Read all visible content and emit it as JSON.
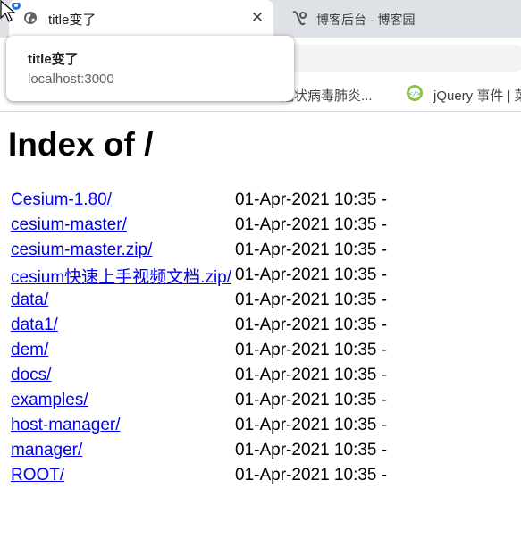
{
  "browser": {
    "active_tab": {
      "title": "title变了",
      "close": "✕",
      "icon": "globe-icon"
    },
    "inactive_tab": {
      "title": "博客后台 - 博客园",
      "icon": "cnblogs-icon"
    },
    "bookmarks": [
      {
        "label": "冠状病毒肺炎...",
        "icon": "none"
      },
      {
        "label": "jQuery 事件 | 菜",
        "icon": "code-icon"
      }
    ],
    "tooltip": {
      "title": "title变了",
      "url": "localhost:3000"
    }
  },
  "page": {
    "heading": "Index of /",
    "entries": [
      {
        "name": "Cesium-1.80/",
        "date": "01-Apr-2021 10:35",
        "size": "-"
      },
      {
        "name": "cesium-master/",
        "date": "01-Apr-2021 10:35",
        "size": "-"
      },
      {
        "name": "cesium-master.zip/",
        "date": "01-Apr-2021 10:35",
        "size": "-"
      },
      {
        "name": "cesium快速上手视频文档.zip/",
        "date": "01-Apr-2021 10:35",
        "size": "-"
      },
      {
        "name": "data/",
        "date": "01-Apr-2021 10:35",
        "size": "-"
      },
      {
        "name": "data1/",
        "date": "01-Apr-2021 10:35",
        "size": "-"
      },
      {
        "name": "dem/",
        "date": "01-Apr-2021 10:35",
        "size": "-"
      },
      {
        "name": "docs/",
        "date": "01-Apr-2021 10:35",
        "size": "-"
      },
      {
        "name": "examples/",
        "date": "01-Apr-2021 10:35",
        "size": "-"
      },
      {
        "name": "host-manager/",
        "date": "01-Apr-2021 10:35",
        "size": "-"
      },
      {
        "name": "manager/",
        "date": "01-Apr-2021 10:35",
        "size": "-"
      },
      {
        "name": "ROOT/",
        "date": "01-Apr-2021 10:35",
        "size": "-"
      }
    ]
  },
  "colors": {
    "link": "#0000ee",
    "tabstrip": "#dee1e6",
    "tooltip_url": "#5f6368"
  }
}
